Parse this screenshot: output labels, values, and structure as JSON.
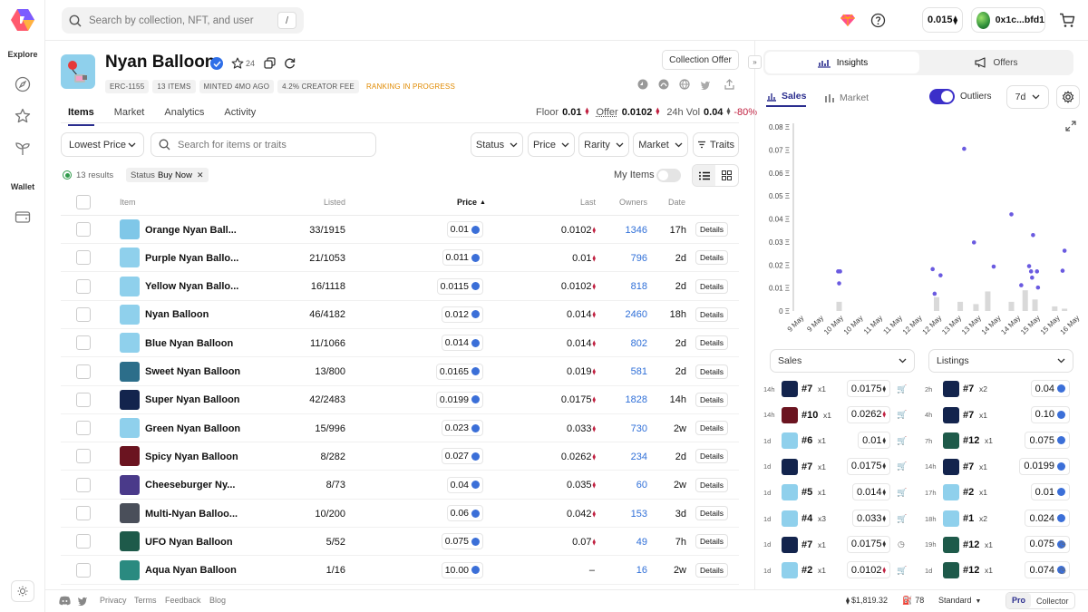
{
  "rail": {
    "explore_label": "Explore",
    "wallet_label": "Wallet"
  },
  "topbar": {
    "search_placeholder": "Search by collection, NFT, and user",
    "search_shortcut": "/",
    "balance": "0.015",
    "wallet_address": "0x1c...bfd1"
  },
  "collection": {
    "name": "Nyan Balloon",
    "star_count": "24",
    "tags": [
      "ERC-1155",
      "13 ITEMS",
      "MINTED 4MO AGO",
      "4.2% CREATOR FEE"
    ],
    "ranking": "RANKING IN PROGRESS",
    "offer_button": "Collection Offer",
    "tabs": [
      "Items",
      "Market",
      "Analytics",
      "Activity"
    ],
    "stats": {
      "floor_label": "Floor",
      "floor": "0.01",
      "offer_label": "Offer",
      "offer": "0.0102",
      "vol_label": "24h Vol",
      "vol": "0.04",
      "vol_change": "-80%"
    }
  },
  "filters": {
    "sort": "Lowest Price",
    "search_placeholder": "Search for items or traits",
    "buttons": [
      "Status",
      "Price",
      "Rarity",
      "Market"
    ],
    "traits": "Traits",
    "results": "13 results",
    "chip_label": "Status",
    "chip_value": "Buy Now",
    "my_items": "My Items"
  },
  "table": {
    "headers": {
      "item": "Item",
      "listed": "Listed",
      "price": "Price",
      "last": "Last",
      "owners": "Owners",
      "date": "Date"
    },
    "details_label": "Details",
    "rows": [
      {
        "name": "Orange Nyan Ball...",
        "listed": "33/1915",
        "price": "0.01",
        "last": "0.0102",
        "owners": "1346",
        "date": "17h",
        "color": "#7fc7e8"
      },
      {
        "name": "Purple Nyan Ballo...",
        "listed": "21/1053",
        "price": "0.011",
        "last": "0.01",
        "owners": "796",
        "date": "2d",
        "color": "#8fd0ec"
      },
      {
        "name": "Yellow Nyan Ballo...",
        "listed": "16/1118",
        "price": "0.0115",
        "last": "0.0102",
        "owners": "818",
        "date": "2d",
        "color": "#8fd0ec"
      },
      {
        "name": "Nyan Balloon",
        "listed": "46/4182",
        "price": "0.012",
        "last": "0.014",
        "owners": "2460",
        "date": "18h",
        "color": "#8fd0ec"
      },
      {
        "name": "Blue Nyan Balloon",
        "listed": "11/1066",
        "price": "0.014",
        "last": "0.014",
        "owners": "802",
        "date": "2d",
        "color": "#8fd0ec"
      },
      {
        "name": "Sweet Nyan Balloon",
        "listed": "13/800",
        "price": "0.0165",
        "last": "0.019",
        "owners": "581",
        "date": "2d",
        "color": "#2c6e8a"
      },
      {
        "name": "Super Nyan Balloon",
        "listed": "42/2483",
        "price": "0.0199",
        "last": "0.0175",
        "owners": "1828",
        "date": "14h",
        "color": "#13244d"
      },
      {
        "name": "Green Nyan Balloon",
        "listed": "15/996",
        "price": "0.023",
        "last": "0.033",
        "owners": "730",
        "date": "2w",
        "color": "#8fd0ec"
      },
      {
        "name": "Spicy Nyan Balloon",
        "listed": "8/282",
        "price": "0.027",
        "last": "0.0262",
        "owners": "234",
        "date": "2d",
        "color": "#6b1420"
      },
      {
        "name": "Cheeseburger Ny...",
        "listed": "8/73",
        "price": "0.04",
        "last": "0.035",
        "owners": "60",
        "date": "2w",
        "color": "#4a3a8a"
      },
      {
        "name": "Multi-Nyan Balloo...",
        "listed": "10/200",
        "price": "0.06",
        "last": "0.042",
        "owners": "153",
        "date": "3d",
        "color": "#4a4f5a"
      },
      {
        "name": "UFO Nyan Balloon",
        "listed": "5/52",
        "price": "0.075",
        "last": "0.07",
        "owners": "49",
        "date": "7h",
        "color": "#1e5a4a"
      },
      {
        "name": "Aqua Nyan Balloon",
        "listed": "1/16",
        "price": "10.00",
        "last": "–",
        "owners": "16",
        "date": "2w",
        "color": "#2a8a80"
      }
    ]
  },
  "insights": {
    "tab_insights": "Insights",
    "tab_offers": "Offers",
    "sub_sales": "Sales",
    "sub_market": "Market",
    "outliers": "Outliers",
    "range": "7d"
  },
  "chart_data": {
    "type": "scatter",
    "ylim": [
      0,
      0.08
    ],
    "y_ticks": [
      "0.08 Ξ",
      "0.07 Ξ",
      "0.06 Ξ",
      "0.05 Ξ",
      "0.04 Ξ",
      "0.03 Ξ",
      "0.02 Ξ",
      "0.01 Ξ",
      "0 Ξ"
    ],
    "categories": [
      "9 May",
      "9 May",
      "10 May",
      "10 May",
      "11 May",
      "11 May",
      "12 May",
      "12 May",
      "13 May",
      "13 May",
      "14 May",
      "14 May",
      "15 May",
      "15 May",
      "16 May"
    ],
    "points": [
      {
        "x": 2.0,
        "y": 0.0172
      },
      {
        "x": 2.1,
        "y": 0.0172
      },
      {
        "x": 2.05,
        "y": 0.012
      },
      {
        "x": 6.8,
        "y": 0.0182
      },
      {
        "x": 6.9,
        "y": 0.0075
      },
      {
        "x": 7.2,
        "y": 0.0155
      },
      {
        "x": 8.4,
        "y": 0.0705
      },
      {
        "x": 8.9,
        "y": 0.0298
      },
      {
        "x": 9.9,
        "y": 0.0193
      },
      {
        "x": 10.8,
        "y": 0.042
      },
      {
        "x": 11.3,
        "y": 0.0112
      },
      {
        "x": 11.7,
        "y": 0.0195
      },
      {
        "x": 11.8,
        "y": 0.0172
      },
      {
        "x": 11.85,
        "y": 0.0145
      },
      {
        "x": 11.9,
        "y": 0.033
      },
      {
        "x": 12.1,
        "y": 0.0172
      },
      {
        "x": 12.15,
        "y": 0.0102
      },
      {
        "x": 13.5,
        "y": 0.0262
      },
      {
        "x": 13.4,
        "y": 0.0175
      }
    ],
    "volume_bars": [
      {
        "x": 2.05,
        "h": 0.004
      },
      {
        "x": 7.0,
        "h": 0.006
      },
      {
        "x": 8.2,
        "h": 0.004
      },
      {
        "x": 9.0,
        "h": 0.003
      },
      {
        "x": 9.6,
        "h": 0.0085
      },
      {
        "x": 10.8,
        "h": 0.004
      },
      {
        "x": 11.5,
        "h": 0.009
      },
      {
        "x": 12.0,
        "h": 0.005
      },
      {
        "x": 13.0,
        "h": 0.002
      },
      {
        "x": 13.5,
        "h": 0.001
      }
    ]
  },
  "sales_list": {
    "dropdown": "Sales",
    "items": [
      {
        "age": "14h",
        "id": "#7",
        "qty": "x1",
        "price": "0.0175",
        "color": "#13244d"
      },
      {
        "age": "14h",
        "id": "#10",
        "qty": "x1",
        "price": "0.0262",
        "color": "#6b1420"
      },
      {
        "age": "1d",
        "id": "#6",
        "qty": "x1",
        "price": "0.01",
        "color": "#8fd0ec"
      },
      {
        "age": "1d",
        "id": "#7",
        "qty": "x1",
        "price": "0.0175",
        "color": "#13244d"
      },
      {
        "age": "1d",
        "id": "#5",
        "qty": "x1",
        "price": "0.014",
        "color": "#8fd0ec"
      },
      {
        "age": "1d",
        "id": "#4",
        "qty": "x3",
        "price": "0.033",
        "color": "#8fd0ec"
      },
      {
        "age": "1d",
        "id": "#7",
        "qty": "x1",
        "price": "0.0175",
        "color": "#13244d"
      },
      {
        "age": "1d",
        "id": "#2",
        "qty": "x1",
        "price": "0.0102",
        "color": "#8fd0ec"
      }
    ]
  },
  "listings_list": {
    "dropdown": "Listings",
    "items": [
      {
        "age": "2h",
        "id": "#7",
        "qty": "x2",
        "price": "0.04",
        "color": "#13244d"
      },
      {
        "age": "4h",
        "id": "#7",
        "qty": "x1",
        "price": "0.10",
        "color": "#13244d"
      },
      {
        "age": "7h",
        "id": "#12",
        "qty": "x1",
        "price": "0.075",
        "color": "#1e5a4a"
      },
      {
        "age": "14h",
        "id": "#7",
        "qty": "x1",
        "price": "0.0199",
        "color": "#13244d"
      },
      {
        "age": "17h",
        "id": "#2",
        "qty": "x1",
        "price": "0.01",
        "color": "#8fd0ec"
      },
      {
        "age": "18h",
        "id": "#1",
        "qty": "x2",
        "price": "0.024",
        "color": "#8fd0ec"
      },
      {
        "age": "19h",
        "id": "#12",
        "qty": "x1",
        "price": "0.075",
        "color": "#1e5a4a"
      },
      {
        "age": "1d",
        "id": "#12",
        "qty": "x1",
        "price": "0.074",
        "color": "#1e5a4a"
      }
    ]
  },
  "footer": {
    "links": [
      "Privacy",
      "Terms",
      "Feedback",
      "Blog"
    ],
    "eth_price": "$1,819.32",
    "gas": "78",
    "mode": "Standard",
    "pro": "Pro",
    "collector": "Collector"
  },
  "colors": {
    "accent": "#2a2d8e",
    "eth_blue": "#3b6fd8",
    "price_up": "#c02040",
    "scatter": "#6a5ae0"
  }
}
